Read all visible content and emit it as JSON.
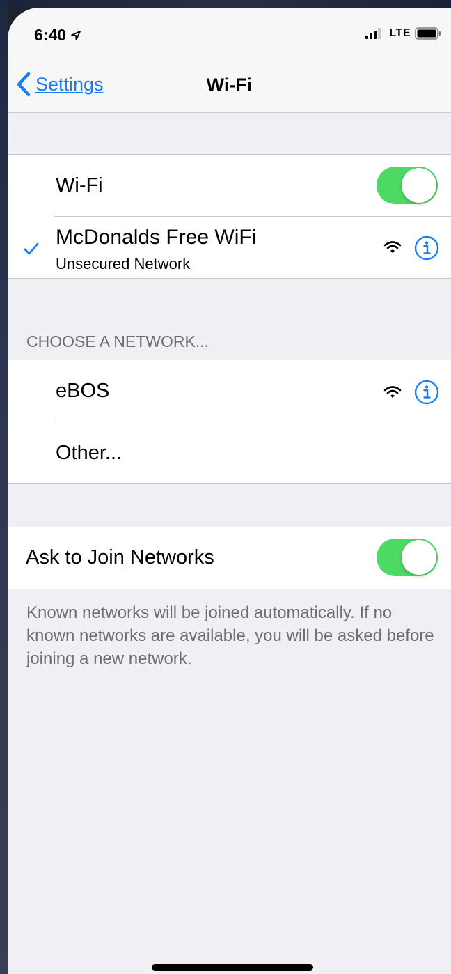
{
  "status_bar": {
    "time": "6:40",
    "network": "LTE"
  },
  "nav": {
    "back_label": "Settings",
    "title": "Wi-Fi"
  },
  "wifi_toggle": {
    "label": "Wi-Fi",
    "on": true
  },
  "connected_network": {
    "name": "McDonalds Free WiFi",
    "subtitle": "Unsecured Network",
    "selected": true
  },
  "choose_section": {
    "header": "CHOOSE A NETWORK...",
    "networks": [
      {
        "name": "eBOS"
      }
    ],
    "other_label": "Other..."
  },
  "ask_to_join": {
    "label": "Ask to Join Networks",
    "on": true,
    "description": "Known networks will be joined automatically. If no known networks are available, you will be asked before joining a new network."
  },
  "colors": {
    "accent": "#1c7cf2",
    "toggle_on": "#4cd964",
    "background": "#efeff4",
    "secondary_text": "#6d6d72"
  },
  "icons": [
    "chevron-left-icon",
    "location-arrow-icon",
    "signal-bars-icon",
    "battery-icon",
    "checkmark-icon",
    "wifi-icon",
    "info-icon"
  ]
}
